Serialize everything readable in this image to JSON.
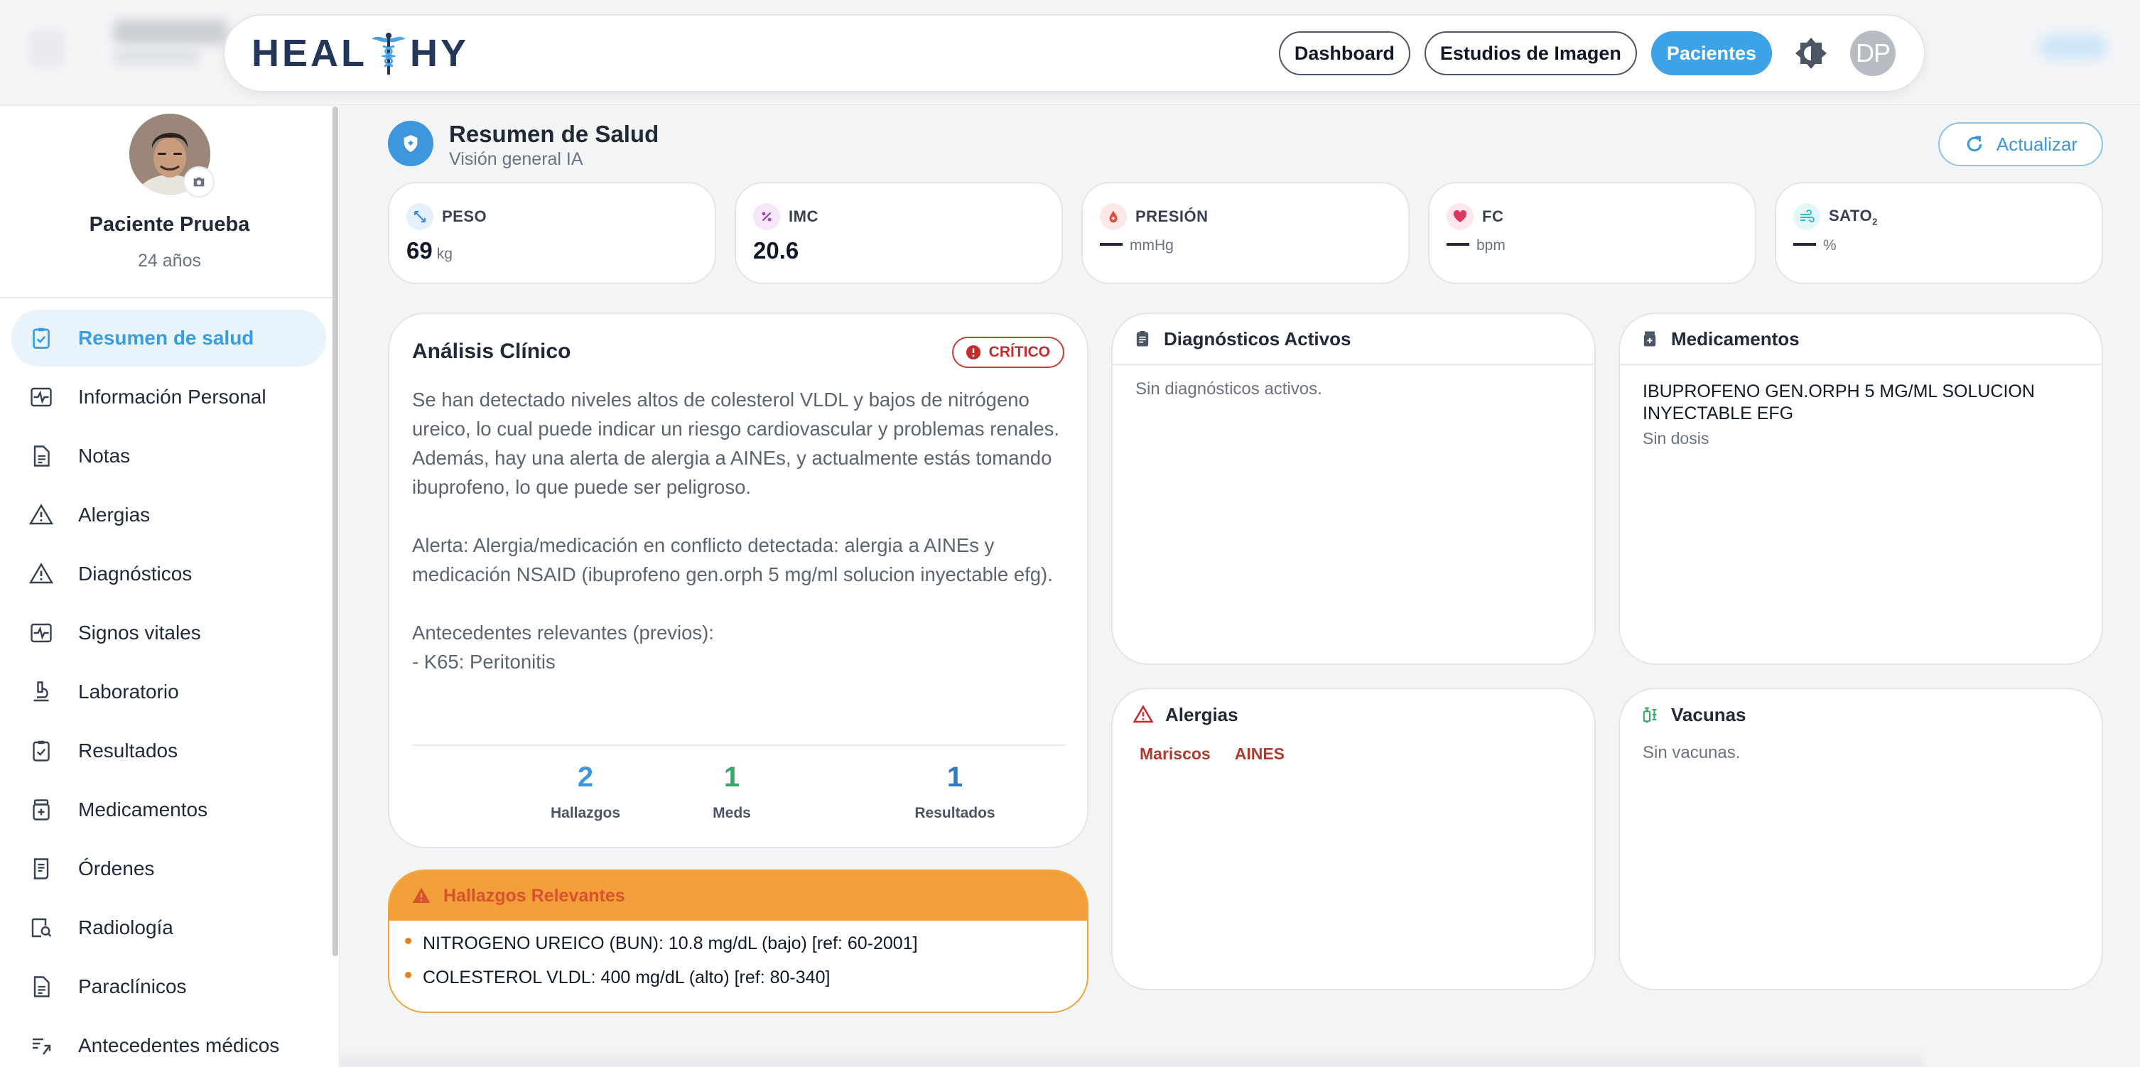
{
  "navbar": {
    "logo_text_left": "HEAL",
    "logo_text_right": "HY",
    "buttons": [
      "Dashboard",
      "Estudios de Imagen",
      "Pacientes"
    ],
    "active_button": "Pacientes",
    "user_initials": "DP"
  },
  "patient": {
    "name": "Paciente Prueba",
    "age": "24 años"
  },
  "sidebar": {
    "items": [
      {
        "label": "Resumen de salud",
        "icon": "checklist-icon",
        "active": true
      },
      {
        "label": "Información Personal",
        "icon": "vitals-card-icon",
        "active": false
      },
      {
        "label": "Notas",
        "icon": "document-icon",
        "active": false
      },
      {
        "label": "Alergias",
        "icon": "warning-icon",
        "active": false
      },
      {
        "label": "Diagnósticos",
        "icon": "warning-icon",
        "active": false
      },
      {
        "label": "Signos vitales",
        "icon": "vitals-card-icon",
        "active": false
      },
      {
        "label": "Laboratorio",
        "icon": "microscope-icon",
        "active": false
      },
      {
        "label": "Resultados",
        "icon": "checklist-icon",
        "active": false
      },
      {
        "label": "Medicamentos",
        "icon": "medication-icon",
        "active": false
      },
      {
        "label": "Órdenes",
        "icon": "receipt-icon",
        "active": false
      },
      {
        "label": "Radiología",
        "icon": "image-search-icon",
        "active": false
      },
      {
        "label": "Paraclínicos",
        "icon": "document-icon",
        "active": false
      },
      {
        "label": "Antecedentes médicos",
        "icon": "history-icon",
        "active": false
      }
    ]
  },
  "summary": {
    "title": "Resumen de Salud",
    "subtitle": "Visión general IA",
    "refresh_label": "Actualizar"
  },
  "vitals": [
    {
      "label": "PESO",
      "value": "69",
      "unit": "kg",
      "icon": "scale-icon",
      "color": "#3a8fd9"
    },
    {
      "label": "IMC",
      "value": "20.6",
      "unit": "",
      "icon": "percent-icon",
      "color": "#a63ab8"
    },
    {
      "label": "PRESIÓN",
      "value": "",
      "unit": "mmHg",
      "icon": "blood-drop-icon",
      "color": "#e24c3b"
    },
    {
      "label": "FC",
      "value": "",
      "unit": "bpm",
      "icon": "heart-icon",
      "color": "#e0335e"
    },
    {
      "label": "SATO",
      "label_sub": "2",
      "value": "",
      "unit": "%",
      "icon": "air-icon",
      "color": "#3ab6c6"
    }
  ],
  "analysis": {
    "title": "Análisis Clínico",
    "badge": "CRÍTICO",
    "paragraphs": [
      "Se han detectado niveles altos de colesterol VLDL y bajos de nitrógeno ureico, lo cual puede indicar un riesgo cardiovascular y problemas renales. Además, hay una alerta de alergia a AINEs, y actualmente estás tomando ibuprofeno, lo que puede ser peligroso.",
      "Alerta: Alergia/medicación en conflicto detectada: alergia a AINEs y medicación NSAID (ibuprofeno gen.orph 5 mg/ml solucion inyectable efg).",
      "Antecedentes relevantes (previos):",
      "- K65: Peritonitis"
    ],
    "stats": [
      {
        "value": "2",
        "label": "Hallazgos",
        "color": "#3e96dc"
      },
      {
        "value": "1",
        "label": "Meds",
        "color": "#3aa66a"
      },
      {
        "value": "1",
        "label": "Resultados",
        "color": "#2f7bc6"
      }
    ]
  },
  "hallazgos": {
    "title": "Hallazgos Relevantes",
    "items": [
      "NITROGENO UREICO (BUN): 10.8 mg/dL (bajo) [ref: 60-2001]",
      "COLESTEROL VLDL: 400 mg/dL (alto) [ref: 80-340]"
    ]
  },
  "diagnosticos": {
    "title": "Diagnósticos Activos",
    "empty": "Sin diagnósticos activos."
  },
  "medicamentos": {
    "title": "Medicamentos",
    "items": [
      {
        "name": "IBUPROFENO GEN.ORPH 5 MG/ML SOLUCION INYECTABLE EFG",
        "dose": "Sin dosis"
      }
    ]
  },
  "alergias": {
    "title": "Alergias",
    "tags": [
      "Mariscos",
      "AINES"
    ]
  },
  "vacunas": {
    "title": "Vacunas",
    "empty": "Sin vacunas."
  }
}
